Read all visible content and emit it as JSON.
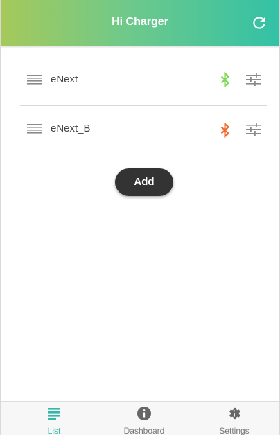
{
  "header": {
    "title": "Hi Charger"
  },
  "devices": [
    {
      "name": "eNext",
      "bluetooth_status_color": "#7ed957",
      "bluetooth_icon": "bluetooth-icon",
      "settings_icon": "tune-icon"
    },
    {
      "name": "eNext_B",
      "bluetooth_status_color": "#f26a2e",
      "bluetooth_icon": "bluetooth-icon",
      "settings_icon": "tune-icon"
    }
  ],
  "actions": {
    "add_label": "Add"
  },
  "bottom_nav": {
    "items": [
      {
        "label": "List",
        "icon": "list-icon",
        "active": true
      },
      {
        "label": "Dashboard",
        "icon": "info-icon",
        "active": false
      },
      {
        "label": "Settings",
        "icon": "gear-icon",
        "active": false
      }
    ]
  },
  "colors": {
    "header_gradient_start": "#a6c95a",
    "header_gradient_end": "#33c1a6",
    "active_tab": "#33b8a8",
    "add_button": "#333333"
  }
}
